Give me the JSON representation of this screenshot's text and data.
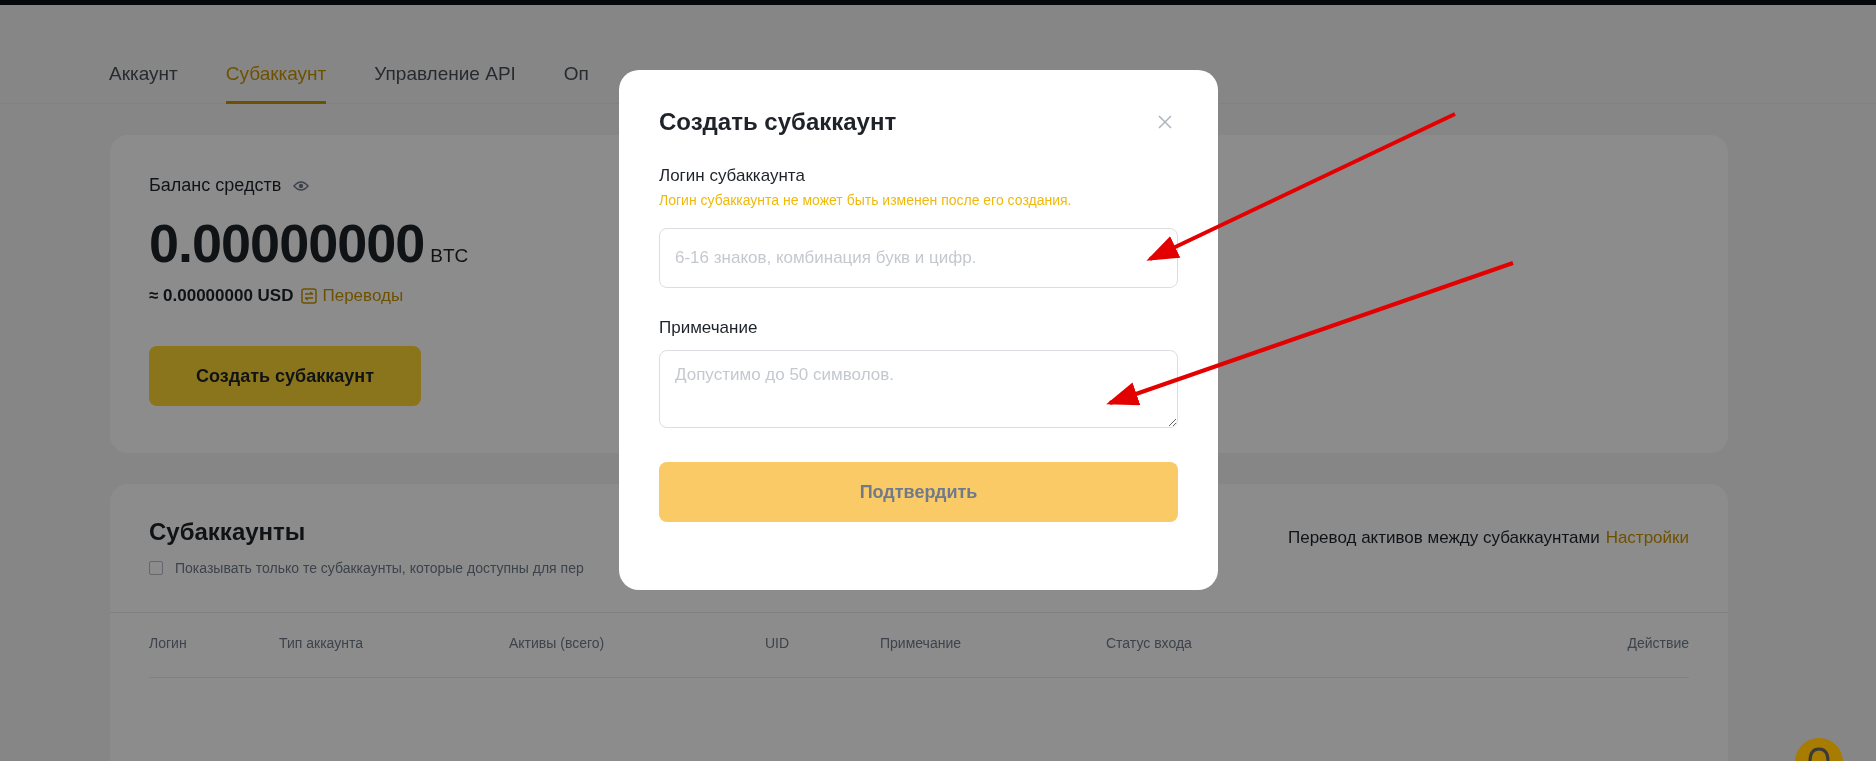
{
  "tabs": [
    {
      "label": "Аккаунт",
      "selected": false
    },
    {
      "label": "Субаккаунт",
      "selected": true
    },
    {
      "label": "Управление API",
      "selected": false
    },
    {
      "label": "Оп",
      "selected": false
    }
  ],
  "balance": {
    "label": "Баланс средств",
    "amount": "0.00000000",
    "unit": "BTC",
    "usd": "≈ 0.00000000 USD",
    "transfers_link": "Переводы",
    "create_button": "Создать субаккаунт"
  },
  "subaccounts": {
    "title": "Субаккаунты",
    "filter": {
      "label": "Показывать только те субаккаунты, которые доступны для пер",
      "checked": false
    },
    "transfer_text": "Перевод активов между субаккаунтами",
    "settings_link": "Настройки",
    "columns": [
      "Логин",
      "Тип аккаунта",
      "Активы (всего)",
      "UID",
      "Примечание",
      "Статус входа",
      "Действие"
    ]
  },
  "modal": {
    "title": "Создать субаккаунт",
    "fields": [
      {
        "kind": "input",
        "label": "Логин субаккаунта",
        "hint": "Логин субаккаунта не может быть изменен после его создания.",
        "placeholder": "6-16 знаков, комбинация букв и цифр."
      },
      {
        "kind": "textarea",
        "label": "Примечание",
        "placeholder": "Допустимо до 50 символов."
      }
    ],
    "confirm_button": {
      "label": "Подтвердить",
      "disabled": true
    }
  }
}
